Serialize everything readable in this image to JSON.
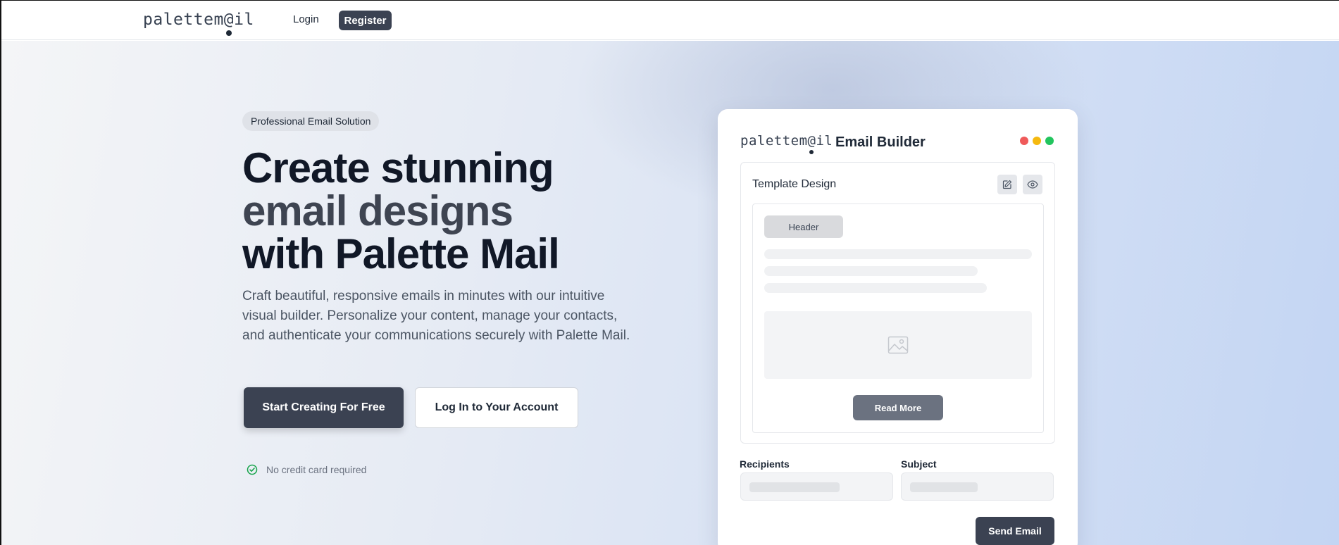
{
  "nav": {
    "logo": {
      "left": "palette",
      "mid": "m",
      "at": "@",
      "right": "il"
    },
    "login_label": "Login",
    "register_label": "Register"
  },
  "hero": {
    "badge": "Professional Email Solution",
    "headline": {
      "line1": "Create stunning",
      "line2": "email designs",
      "line3": "with Palette Mail"
    },
    "description": "Craft beautiful, responsive emails in minutes with our intuitive visual builder. Personalize your content, manage your contacts, and authenticate your communications securely with Palette Mail.",
    "primary_cta": "Start Creating For Free",
    "secondary_cta": "Log In to Your Account",
    "note": "No credit card required",
    "note_icon": "check-circle-icon"
  },
  "builder": {
    "logo": {
      "left": "palette",
      "mid": "m",
      "at": "@",
      "right": "il"
    },
    "title": "Email Builder",
    "window_dots": [
      "#ef5a5a",
      "#f5b90f",
      "#22c55e"
    ],
    "template_title": "Template Design",
    "edit_icon": "edit-icon",
    "view_icon": "eye-icon",
    "preview": {
      "header_chip": "Header",
      "image_icon": "image-icon",
      "button_label": "Read More"
    },
    "recipients_label": "Recipients",
    "subject_label": "Subject",
    "send_label": "Send Email"
  },
  "colors": {
    "primary": "#3b4252",
    "text_dark": "#111827",
    "accent_green": "#16a34a"
  }
}
